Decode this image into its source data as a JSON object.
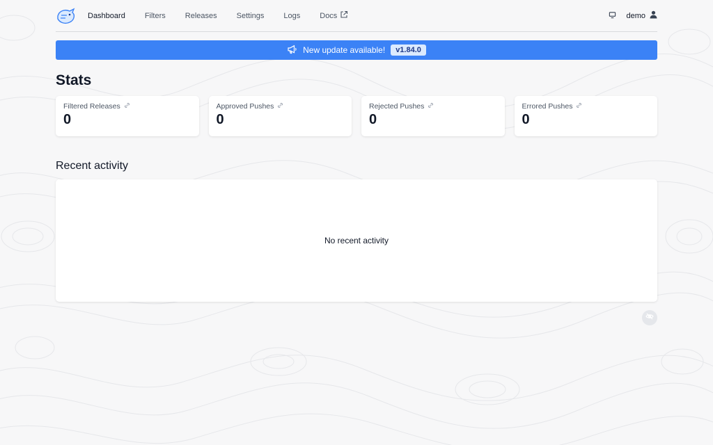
{
  "nav": {
    "items": [
      {
        "label": "Dashboard",
        "active": true
      },
      {
        "label": "Filters"
      },
      {
        "label": "Releases"
      },
      {
        "label": "Settings"
      },
      {
        "label": "Logs"
      },
      {
        "label": "Docs",
        "external": true
      }
    ],
    "user": "demo"
  },
  "banner": {
    "text": "New update available!",
    "version": "v1.84.0"
  },
  "stats": {
    "title": "Stats",
    "cards": [
      {
        "label": "Filtered Releases",
        "value": "0"
      },
      {
        "label": "Approved Pushes",
        "value": "0"
      },
      {
        "label": "Rejected Pushes",
        "value": "0"
      },
      {
        "label": "Errored Pushes",
        "value": "0"
      }
    ]
  },
  "activity": {
    "title": "Recent activity",
    "empty_text": "No recent activity"
  },
  "colors": {
    "accent": "#3b82f6",
    "background": "#f7f7f8",
    "card": "#ffffff"
  }
}
